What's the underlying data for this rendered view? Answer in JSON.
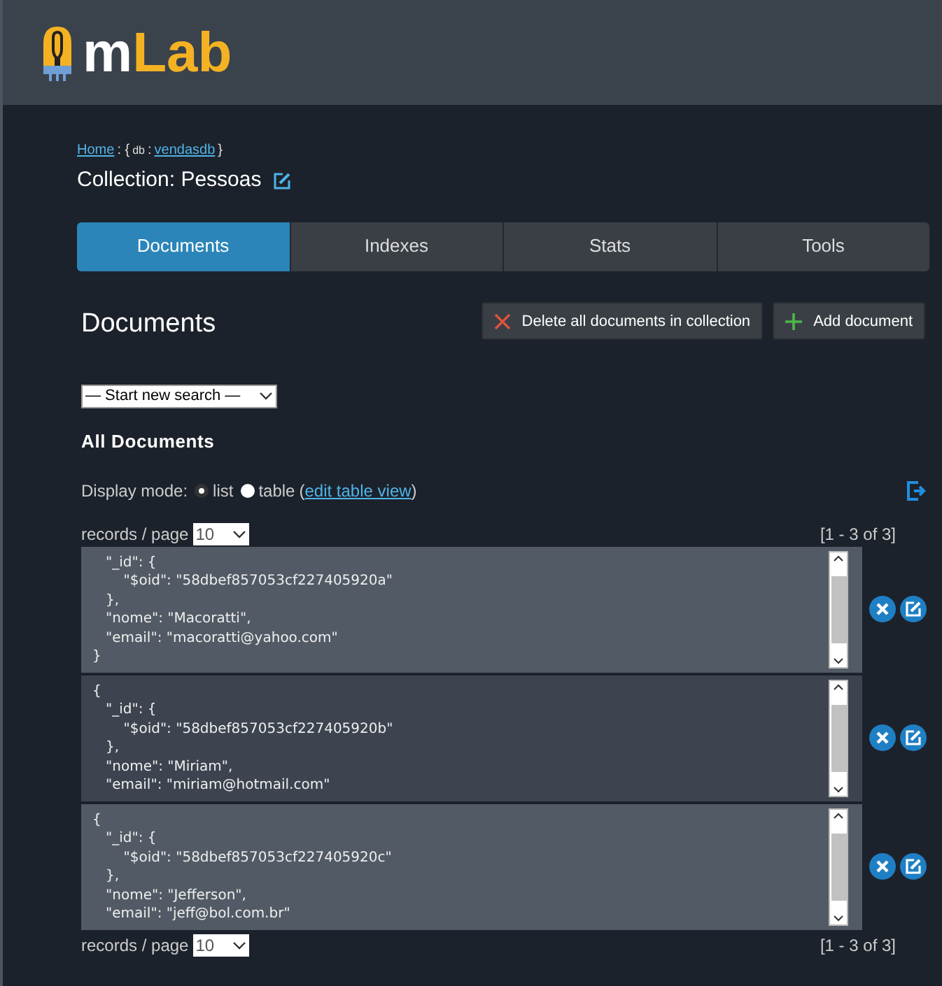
{
  "logo": {
    "text_main": "m",
    "text_accent": "Lab"
  },
  "breadcrumb": {
    "home": "Home",
    "sep": ": {",
    "db_key": "db",
    "colon": ":",
    "db_name": "vendasdb",
    "close": "}"
  },
  "collection_title": "Collection: Pessoas",
  "tabs": [
    {
      "label": "Documents",
      "selected": true
    },
    {
      "label": "Indexes",
      "selected": false
    },
    {
      "label": "Stats",
      "selected": false
    },
    {
      "label": "Tools",
      "selected": false
    }
  ],
  "section_title": "Documents",
  "buttons": [
    {
      "kind": "delete",
      "label": "Delete all documents in collection"
    },
    {
      "kind": "add",
      "label": "Add document"
    }
  ],
  "search_select": {
    "value": "— Start new search —"
  },
  "all_documents_title": "All Documents",
  "display_mode": {
    "label": "Display mode:",
    "options": [
      {
        "label": "list",
        "selected": true
      },
      {
        "label": "table",
        "selected": false
      }
    ],
    "open_paren": "(",
    "link": "edit table view",
    "close_paren": ")"
  },
  "pager_top": {
    "label": "records / page",
    "value": "10",
    "range": "[1 - 3 of 3]"
  },
  "documents": [
    {
      "highlighted": false,
      "text": "   \"_id\": {\n       \"$oid\": \"58dbef857053cf227405920a\"\n   },\n   \"nome\": \"Macoratti\",\n   \"email\": \"macoratti@yahoo.com\"\n}"
    },
    {
      "highlighted": true,
      "text": "{\n   \"_id\": {\n       \"$oid\": \"58dbef857053cf227405920b\"\n   },\n   \"nome\": \"Miriam\",\n   \"email\": \"miriam@hotmail.com\""
    },
    {
      "highlighted": false,
      "text": "{\n   \"_id\": {\n       \"$oid\": \"58dbef857053cf227405920c\"\n   },\n   \"nome\": \"Jefferson\",\n   \"email\": \"jeff@bol.com.br\""
    }
  ],
  "pager_bottom": {
    "label": "records / page",
    "value": "10",
    "range": "[1 - 3 of 3]"
  }
}
